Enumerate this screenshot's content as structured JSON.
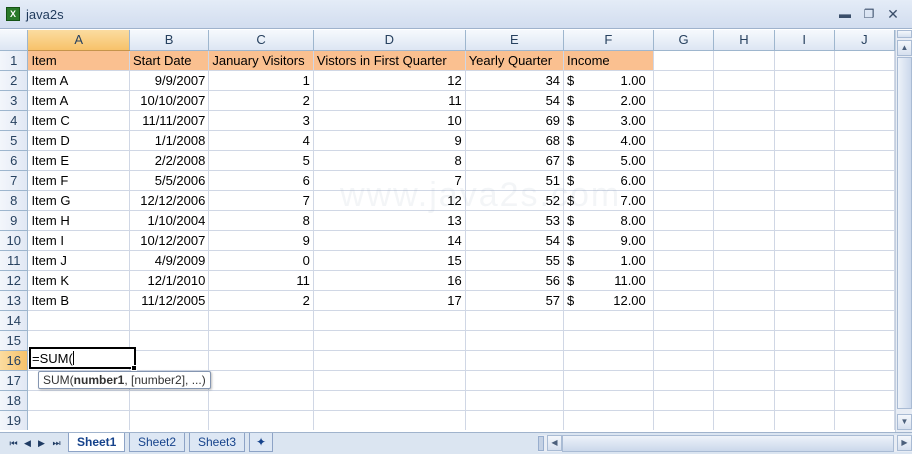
{
  "window": {
    "title": "java2s",
    "app_icon": "excel-icon"
  },
  "columns": [
    "A",
    "B",
    "C",
    "D",
    "E",
    "F",
    "G",
    "H",
    "I",
    "J"
  ],
  "selected_column": "A",
  "rows": [
    "1",
    "2",
    "3",
    "4",
    "5",
    "6",
    "7",
    "8",
    "9",
    "10",
    "11",
    "12",
    "13",
    "14",
    "15",
    "16",
    "17",
    "18",
    "19"
  ],
  "selected_row": "16",
  "header": [
    "Item",
    "Start Date",
    "January Visitors",
    "Vistors in First Quarter",
    "Yearly Quarter",
    "Income"
  ],
  "data": [
    [
      "Item A",
      "9/9/2007",
      "1",
      "12",
      "34",
      "$",
      "1.00"
    ],
    [
      "Item A",
      "10/10/2007",
      "2",
      "11",
      "54",
      "$",
      "2.00"
    ],
    [
      "Item C",
      "11/11/2007",
      "3",
      "10",
      "69",
      "$",
      "3.00"
    ],
    [
      "Item D",
      "1/1/2008",
      "4",
      "9",
      "68",
      "$",
      "4.00"
    ],
    [
      "Item E",
      "2/2/2008",
      "5",
      "8",
      "67",
      "$",
      "5.00"
    ],
    [
      "Item F",
      "5/5/2006",
      "6",
      "7",
      "51",
      "$",
      "6.00"
    ],
    [
      "Item G",
      "12/12/2006",
      "7",
      "12",
      "52",
      "$",
      "7.00"
    ],
    [
      "Item H",
      "1/10/2004",
      "8",
      "13",
      "53",
      "$",
      "8.00"
    ],
    [
      "Item I",
      "10/12/2007",
      "9",
      "14",
      "54",
      "$",
      "9.00"
    ],
    [
      "Item J",
      "4/9/2009",
      "0",
      "15",
      "55",
      "$",
      "1.00"
    ],
    [
      "Item K",
      "12/1/2010",
      "11",
      "16",
      "56",
      "$",
      "11.00"
    ],
    [
      "Item B",
      "11/12/2005",
      "2",
      "17",
      "57",
      "$",
      "12.00"
    ]
  ],
  "editing": {
    "cell": "A16",
    "value": "=SUM(",
    "tooltip_fn": "SUM(",
    "tooltip_arg1": "number1",
    "tooltip_rest": ", [number2], ...)"
  },
  "watermark": "www.java2s.com",
  "sheet_tabs": [
    "Sheet1",
    "Sheet2",
    "Sheet3"
  ],
  "active_sheet": "Sheet1",
  "colors": {
    "header_fill": "#fac090",
    "selected_header": "#f7c26a",
    "grid_line": "#d0d7e5",
    "tab_text": "#15428b"
  }
}
